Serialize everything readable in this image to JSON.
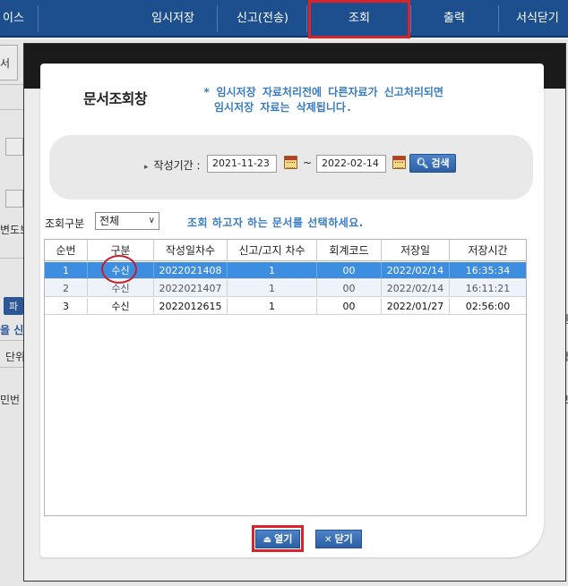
{
  "nav": {
    "items": [
      "이스",
      "임시저장",
      "신고(전송)",
      "조회",
      "출력",
      "서식닫기"
    ]
  },
  "background": {
    "fragments": [
      "서",
      "변도보",
      "을 신",
      "단위",
      "민번",
      "파",
      "정",
      "보",
      "신"
    ]
  },
  "popup": {
    "title": "문서조회창",
    "notice": [
      "* 임시저장 자료처리전에 다른자료가 신고처리되면",
      "임시저장 자료는 삭제됩니다."
    ],
    "search": {
      "label": "작성기간 :",
      "date_from": "2021-11-23",
      "separator": "~",
      "date_to": "2022-02-14",
      "button_label": "검색"
    },
    "filter": {
      "label": "조회구분",
      "selected": "전체",
      "message": "조회 하고자 하는 문서를 선택하세요."
    },
    "table": {
      "columns": [
        "순번",
        "구분",
        "작성일차수",
        "신고/고지 차수",
        "회계코드",
        "저장일",
        "저장시간"
      ],
      "rows": [
        [
          "1",
          "수신",
          "2022021408",
          "1",
          "00",
          "2022/02/14",
          "16:35:34"
        ],
        [
          "2",
          "수신",
          "2022021407",
          "1",
          "00",
          "2022/02/14",
          "16:11:21"
        ],
        [
          "3",
          "수신",
          "2022012615",
          "1",
          "00",
          "2022/01/27",
          "02:56:00"
        ]
      ]
    },
    "buttons": {
      "open_label": "열기",
      "close_label": "닫기"
    }
  },
  "colors": {
    "nav_bg": "#1d4f8f",
    "highlight": "#d8232a",
    "accent_text": "#3a7cc0",
    "selected_row": "#3d8ee0",
    "button_blue": "#2c5fa5"
  }
}
